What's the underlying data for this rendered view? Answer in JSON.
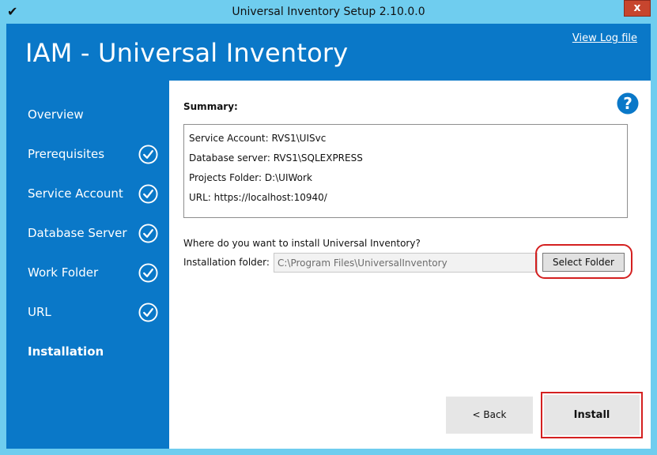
{
  "window": {
    "title": "Universal Inventory Setup 2.10.0.0",
    "app_icon": "checkmark-icon",
    "close_glyph": "x",
    "frame_color": "#6fcdef",
    "close_color": "#c7452e"
  },
  "header": {
    "title": "IAM - Universal Inventory",
    "log_link": "View Log file",
    "background": "#0a78c8"
  },
  "sidebar": {
    "items": [
      {
        "label": "Overview",
        "completed": false,
        "active": false
      },
      {
        "label": "Prerequisites",
        "completed": true,
        "active": false
      },
      {
        "label": "Service Account",
        "completed": true,
        "active": false
      },
      {
        "label": "Database Server",
        "completed": true,
        "active": false
      },
      {
        "label": "Work Folder",
        "completed": true,
        "active": false
      },
      {
        "label": "URL",
        "completed": true,
        "active": false
      },
      {
        "label": "Installation",
        "completed": false,
        "active": true
      }
    ],
    "check_icon": "circle-check-icon"
  },
  "main": {
    "summary_label": "Summary:",
    "help_icon": "help-question-icon",
    "summary_lines": [
      "Service Account: RVS1\\UISvc",
      "Database server: RVS1\\SQLEXPRESS",
      "Projects Folder: D:\\UIWork",
      "URL: https://localhost:10940/"
    ],
    "install_question": "Where do you want to install Universal Inventory?",
    "folder_label": "Installation folder:",
    "folder_value": "C:\\Program Files\\UniversalInventory",
    "select_folder_label": "Select Folder",
    "back_label": "< Back",
    "install_label": "Install",
    "annotation_color": "#d42020"
  }
}
